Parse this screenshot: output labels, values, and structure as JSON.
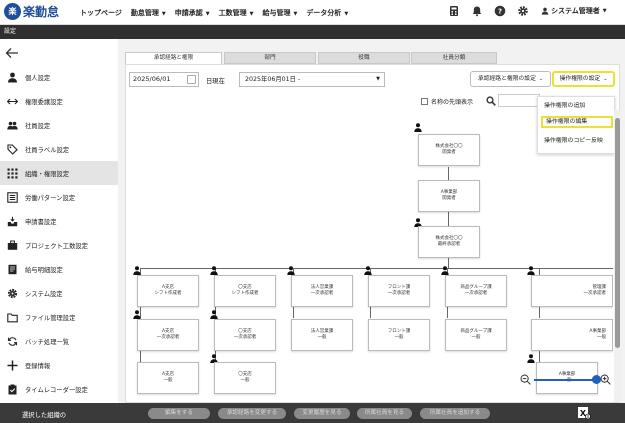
{
  "app": {
    "logo_mark": "楽",
    "logo_text": "楽勤怠"
  },
  "topnav": [
    {
      "label": "トップページ",
      "dropdown": false
    },
    {
      "label": "勤怠管理",
      "dropdown": true
    },
    {
      "label": "申請承認",
      "dropdown": true
    },
    {
      "label": "工数管理",
      "dropdown": true
    },
    {
      "label": "給与管理",
      "dropdown": true
    },
    {
      "label": "データ分析",
      "dropdown": true
    }
  ],
  "user": {
    "name": "システム管理者"
  },
  "page": {
    "title": "設定"
  },
  "sidebar": {
    "items": [
      {
        "label": "個人設定",
        "icon": "person-icon"
      },
      {
        "label": "権限委譲設定",
        "icon": "swap-arrows-icon"
      },
      {
        "label": "社員設定",
        "icon": "people-icon"
      },
      {
        "label": "社員ラベル設定",
        "icon": "tag-icon"
      },
      {
        "label": "組織・権限設定",
        "icon": "org-grid-icon",
        "active": true
      },
      {
        "label": "労働パターン設定",
        "icon": "list-icon"
      },
      {
        "label": "申請書設定",
        "icon": "inbox-icon"
      },
      {
        "label": "プロジェクト工数設定",
        "icon": "briefcase-icon"
      },
      {
        "label": "給与明細設定",
        "icon": "document-icon"
      },
      {
        "label": "システム設定",
        "icon": "gear-icon"
      },
      {
        "label": "ファイル管理設定",
        "icon": "folder-icon"
      },
      {
        "label": "バッチ処理一覧",
        "icon": "sync-icon"
      },
      {
        "label": "登録情報",
        "icon": "plus-icon"
      },
      {
        "label": "タイムレコーダー設定",
        "icon": "timecard-icon"
      }
    ]
  },
  "tabs": [
    {
      "label": "承認経路と権限",
      "active": true
    },
    {
      "label": "部門"
    },
    {
      "label": "役職"
    },
    {
      "label": "社員分類"
    }
  ],
  "toolbar": {
    "date_value": "2025/06/01",
    "date_suffix": "日現在",
    "period_value": "2025年06月01日 -",
    "route_button": "承認経路と権限の設定",
    "perm_button": "操作権限の設定"
  },
  "options": {
    "show_head_label": "名称の先頭表示",
    "search_placeholder": ""
  },
  "perm_menu": {
    "items": [
      "操作権限の追加",
      "操作権限の編集",
      "操作権限のコピー反映"
    ],
    "highlighted_index": 1
  },
  "org": {
    "root": [
      "株式会社〇〇",
      "開発者"
    ],
    "second": [
      "A事業部",
      "開発者"
    ],
    "third": [
      "株式会社〇〇",
      "最終承認者"
    ],
    "row1": [
      [
        "A支店",
        "シフト作成者"
      ],
      [
        "〇支店",
        "シフト作成者"
      ],
      [
        "法人営業課",
        "一次承認者"
      ],
      [
        "フロント課",
        "一次承認者"
      ],
      [
        "商品グループ課",
        "一次承認者"
      ],
      [
        "管理課",
        "一次承認者"
      ]
    ],
    "row2": [
      [
        "A支店",
        "一次承認者"
      ],
      [
        "〇支店",
        "一次承認者"
      ],
      [
        "法人営業課",
        "一般"
      ],
      [
        "フロント課",
        "一般"
      ],
      [
        "商品グループ課",
        "一般"
      ],
      [
        "A事業部",
        "一般"
      ]
    ],
    "row3": [
      [
        "A支店",
        "一般"
      ],
      [
        "〇支店",
        "一般"
      ]
    ],
    "partial_last": [
      "A事業部",
      "一般"
    ]
  },
  "footer": {
    "label": "選択した組織の",
    "buttons": [
      "編集をする",
      "承認経路を変更する",
      "変更履歴を見る",
      "所属社員を見る",
      "所属社員を追加する"
    ]
  },
  "colors": {
    "brand": "#1f4e9c",
    "highlight": "#e8e235",
    "darkbar": "#2f2f2f",
    "footer": "#3a3a3a",
    "zoom": "#1f5fbf"
  }
}
